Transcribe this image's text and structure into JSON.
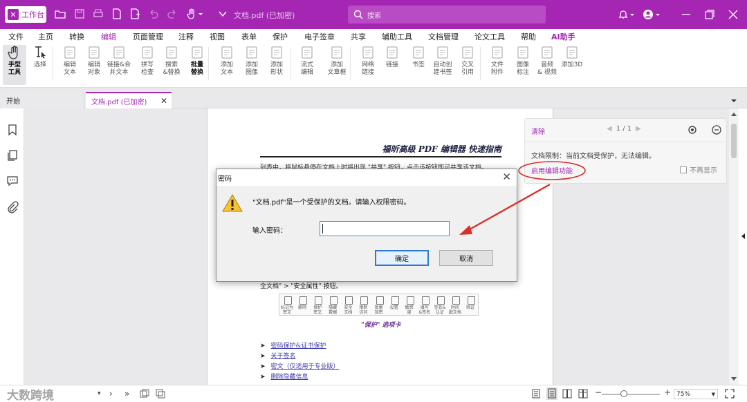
{
  "titlebar": {
    "workbench_label": "工作台",
    "doc_name": "文档.pdf (已加密)",
    "search_placeholder": "搜索"
  },
  "menu": [
    "文件",
    "主页",
    "转换",
    "编辑",
    "页面管理",
    "注释",
    "视图",
    "表单",
    "保护",
    "电子签章",
    "共享",
    "辅助工具",
    "文档管理",
    "论文工具",
    "帮助",
    "AI助手"
  ],
  "menu_active": "编辑",
  "ribbon": [
    {
      "label": "手型\n工具",
      "icon": "hand-icon"
    },
    {
      "label": "选择",
      "icon": "select-icon"
    },
    {
      "label": "编辑\n文本",
      "icon": "edit-text-icon"
    },
    {
      "label": "编辑\n对象",
      "icon": "edit-object-icon"
    },
    {
      "label": "链接&合\n并文本",
      "icon": "link-merge-icon"
    },
    {
      "label": "拼写\n检查",
      "icon": "spell-check-icon"
    },
    {
      "label": "搜索\n&替换",
      "icon": "search-replace-icon"
    },
    {
      "label": "批量\n替换",
      "icon": "batch-replace-icon"
    },
    {
      "label": "添加\n文本",
      "icon": "add-text-icon"
    },
    {
      "label": "添加\n图像",
      "icon": "add-image-icon"
    },
    {
      "label": "添加\n形状",
      "icon": "add-shape-icon"
    },
    {
      "label": "流式\n编辑",
      "icon": "flow-edit-icon"
    },
    {
      "label": "添加\n文章框",
      "icon": "add-article-icon"
    },
    {
      "label": "网络\n链接",
      "icon": "web-link-icon"
    },
    {
      "label": "链接",
      "icon": "link-icon"
    },
    {
      "label": "书签",
      "icon": "bookmark-icon"
    },
    {
      "label": "自动创\n建书签",
      "icon": "auto-bookmark-icon"
    },
    {
      "label": "交叉\n引用",
      "icon": "cross-ref-icon"
    },
    {
      "label": "文件\n附件",
      "icon": "file-attach-icon"
    },
    {
      "label": "图像\n标注",
      "icon": "image-annot-icon"
    },
    {
      "label": "音频\n& 视频",
      "icon": "audio-video-icon"
    },
    {
      "label": "添加3D",
      "icon": "add-3d-icon"
    }
  ],
  "tabs": {
    "start": "开始",
    "doc": "文档.pdf (已加密)"
  },
  "document": {
    "title": "福昕高级 PDF 编辑器 快速指南",
    "line1": "列表中，将鼠标悬停在文档上时将出现 \"共享\" 按钮，点击该按钮即可共享该文档。",
    "line2": "全文档\" > \"安全属性\" 按钮。",
    "toolbar_items": [
      "标记为\n密文",
      "删除",
      "保护\n密文",
      "隐藏\n数据",
      "安全\n文档",
      "限制\n访问",
      "批量\n加密",
      "设置",
      "敏感\n度",
      "填写\n&签名",
      "签名&\n认证",
      "时间\n戳文档",
      "验证"
    ],
    "caption": "\"保护\" 选项卡",
    "links": [
      "密码保护&证书保护",
      "关于签名",
      "密文（仅适用于专业版）",
      "删除隐藏信息"
    ]
  },
  "notice": {
    "clear": "清除",
    "page_indicator": "1 / 1",
    "message": "文档限制：当前文档受保护，无法编辑。",
    "enable_edit": "启用编辑功能",
    "dont_show": "不再显示"
  },
  "dialog": {
    "title": "密码",
    "message": "\"文档.pdf\"是一个受保护的文档。请输入权限密码。",
    "password_label": "输入密码：",
    "password_value": "",
    "ok": "确定",
    "cancel": "取消"
  },
  "status": {
    "watermark": "大数跨境",
    "zoom": "75%"
  },
  "colors": {
    "brand": "#a626b4",
    "annotation_red": "#d9302a"
  }
}
